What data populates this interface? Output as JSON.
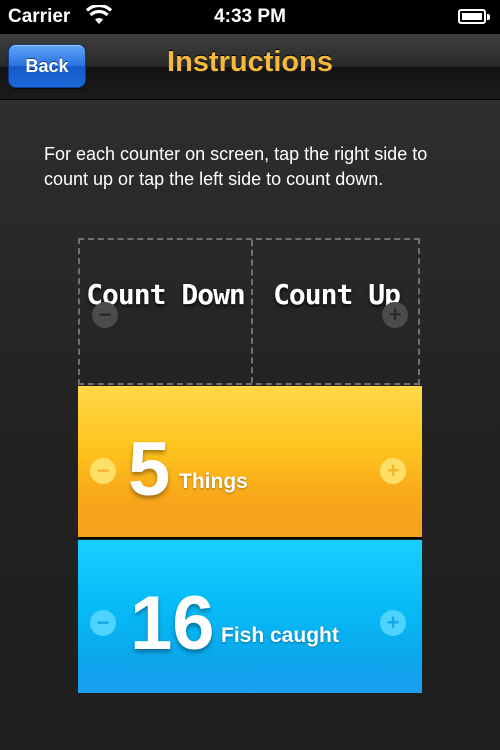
{
  "status_bar": {
    "carrier": "Carrier",
    "time": "4:33 PM"
  },
  "nav": {
    "back_label": "Back",
    "title": "Instructions",
    "title_color": "#f6b93b"
  },
  "instructions": {
    "text": "For each counter on screen, tap the right side to count up or tap the left side to count down."
  },
  "demo": {
    "left_label": "Count Down",
    "right_label": "Count Up",
    "minus_icon": "minus-circle-icon",
    "plus_icon": "plus-circle-icon"
  },
  "counters": [
    {
      "value": "5",
      "name": "Things",
      "color": "#ffc51e"
    },
    {
      "value": "16",
      "name": "Fish caught",
      "color": "#07bdf8"
    }
  ],
  "icons": {
    "minus": "−",
    "plus": "+"
  }
}
